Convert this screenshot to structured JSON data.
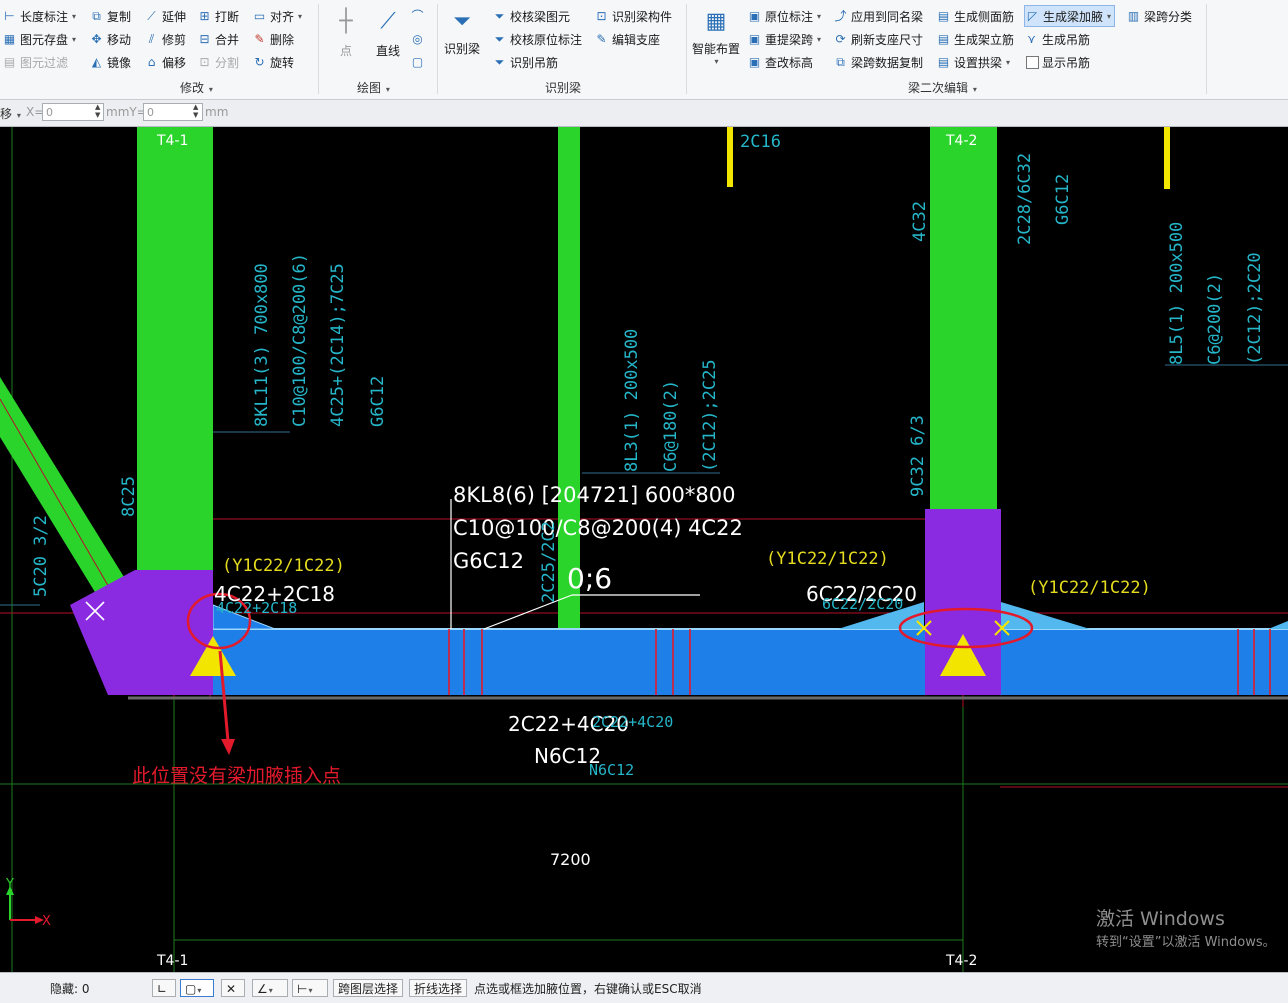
{
  "ribbon": {
    "modify": {
      "length_dim": "长度标注",
      "copy": "复制",
      "extend": "延伸",
      "break": "打断",
      "align": "对齐",
      "element_save": "图元存盘",
      "move": "移动",
      "trim": "修剪",
      "merge": "合并",
      "delete": "删除",
      "element_filter": "图元过滤",
      "mirror": "镜像",
      "offset": "偏移",
      "split": "分割",
      "rotate": "旋转",
      "group_label": "修改"
    },
    "draw": {
      "point": "点",
      "line": "直线",
      "group_label": "绘图"
    },
    "recognize": {
      "recognize_beam": "识别梁",
      "check_beam_element": "校核梁图元",
      "recognize_beam_member": "识别梁构件",
      "check_original_annotation": "校核原位标注",
      "edit_support": "编辑支座",
      "recognize_hanger": "识别吊筋",
      "group_label": "识别梁"
    },
    "secondary": {
      "smart_layout": "智能布置",
      "original_annotation": "原位标注",
      "apply_same_name": "应用到同名梁",
      "generate_side_rebar": "生成侧面筋",
      "generate_haunch": "生成梁加腋",
      "span_classify": "梁跨分类",
      "re_extract_span": "重提梁跨",
      "refresh_support_size": "刷新支座尺寸",
      "generate_erect_rebar": "生成架立筋",
      "generate_hanger": "生成吊筋",
      "check_elevation": "查改标高",
      "span_data_copy": "梁跨数据复制",
      "set_arch_beam": "设置拱梁",
      "show_hanger": "显示吊筋",
      "group_label": "梁二次编辑"
    }
  },
  "coordbar": {
    "mode": "移",
    "x_label": "X=",
    "x_value": "0",
    "unit_mid": "mmY=",
    "y_value": "0",
    "unit_end": "mm"
  },
  "canvas": {
    "axes_top_left": "T4-1",
    "axes_top_right": "T4-2",
    "axes_bottom_left": "T4-1",
    "axes_bottom_right": "T4-2",
    "beam_label_line1": "8KL8(6) [204721] 600*800",
    "beam_label_line2": "C10@100/C8@200(4) 4C22",
    "beam_label_line3": "G6C12",
    "haunch_ratio": "0;6",
    "left_support_top": "4C22+2C18",
    "left_support_top_cad": "4C22+2C18",
    "right_support_top": "6C22/2C20",
    "right_support_top_cad": "6C22/2C20",
    "haunch_left": "(Y1C22/1C22)",
    "haunch_mid": "(Y1C22/1C22)",
    "haunch_right": "(Y1C22/1C22)",
    "bottom_rebar": "2C22+4C20",
    "bottom_rebar_cad": "2C22+4C20",
    "bottom_extra": "N6C12",
    "bottom_extra_cad": "N6C12",
    "dimension": "7200",
    "annotation_no_haunch": "此位置没有梁加腋插入点",
    "vt_kl11": "8KL11(3) 700x800",
    "vt_kl11_b": "C10@100/C8@200(6)",
    "vt_kl11_c": "4C25+(2C14);7C25",
    "vt_kl11_d": "G6C12",
    "vt_8c25": "8C25",
    "vt_5c20": "5C20 3/2",
    "vt_l3": "8L3(1) 200x500",
    "vt_l3_b": "C6@180(2)",
    "vt_l3_c": "(2C12);2C25",
    "vt_2c25": "2C25/2C2",
    "vt_2c16": "2C16",
    "vt_4c32": "4C32",
    "vt_9c32": "9C32 6/3",
    "vt_2c28": "2C28/6C32",
    "vt_g6c12": "G6C12",
    "vt_l5": "8L5(1) 200x500",
    "vt_l5_b": "C6@200(2)",
    "vt_l5_c": "(2C12);2C20",
    "axis_y": "Y",
    "axis_x": "X",
    "watermark_1": "激活 Windows",
    "watermark_2": "转到“设置”以激活 Windows。"
  },
  "statusbar": {
    "hidden_label": "隐藏: 0",
    "cross_layer": "跨图层选择",
    "polyline_select": "折线选择",
    "hint": "点选或框选加腋位置，右键确认或ESC取消"
  }
}
